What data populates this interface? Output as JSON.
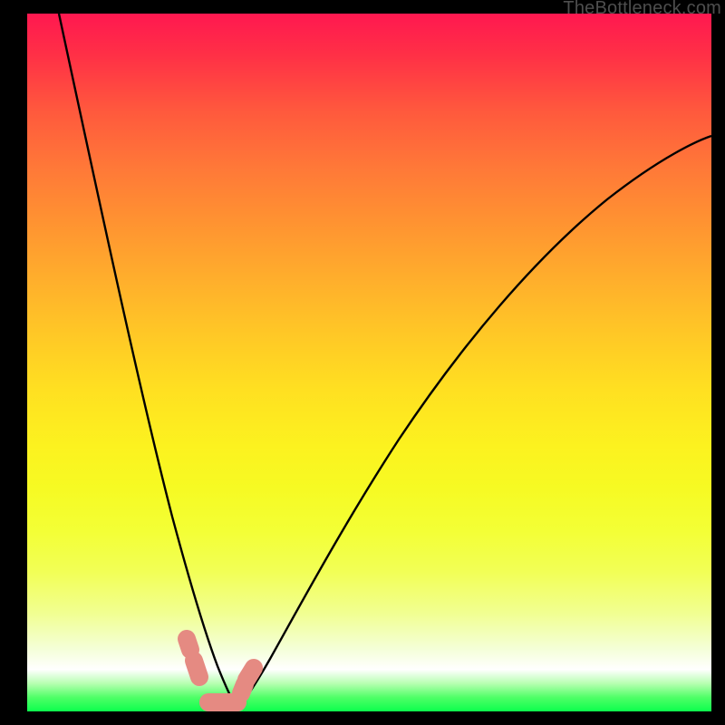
{
  "watermark": "TheBottleneck.com",
  "colors": {
    "background": "#000000",
    "curve": "#000000",
    "watermark_text": "#4e4e4e",
    "marker": "#e58a82",
    "gradient_top": "#ff1850",
    "gradient_mid": "#ffe021",
    "gradient_bottom": "#0cff4d"
  },
  "chart_data": {
    "type": "line",
    "title": "",
    "xlabel": "",
    "ylabel": "",
    "xlim": [
      0,
      100
    ],
    "ylim": [
      0,
      100
    ],
    "series": [
      {
        "name": "bottleneck-curve-left",
        "x": [
          4,
          6,
          8,
          10,
          12,
          14,
          16,
          18,
          20,
          22,
          24,
          26,
          27,
          28,
          29,
          30
        ],
        "values": [
          100,
          90,
          80,
          71,
          62,
          53,
          45,
          37,
          29,
          22,
          15,
          8,
          5,
          3,
          1,
          0
        ]
      },
      {
        "name": "bottleneck-curve-right",
        "x": [
          30,
          32,
          34,
          36,
          38,
          40,
          44,
          48,
          52,
          56,
          60,
          66,
          72,
          78,
          84,
          90,
          96,
          100
        ],
        "values": [
          0,
          2,
          5,
          9,
          13,
          17,
          25,
          32,
          39,
          45,
          51,
          58,
          64,
          69,
          73,
          77,
          80,
          82
        ]
      }
    ],
    "annotations": [
      {
        "name": "marker-left-upper",
        "x": 23.5,
        "y": 10
      },
      {
        "name": "marker-left-lower",
        "x": 24.5,
        "y": 6
      },
      {
        "name": "marker-right-upper",
        "x": 32.5,
        "y": 6
      },
      {
        "name": "marker-right-lower",
        "x": 31.5,
        "y": 3
      },
      {
        "name": "marker-bottom",
        "x": 29,
        "y": 0.8
      }
    ],
    "grid": false,
    "legend": false
  }
}
